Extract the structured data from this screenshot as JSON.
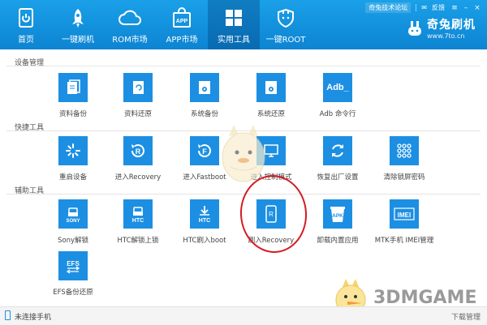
{
  "nav": {
    "items": [
      {
        "label": "首页",
        "icon": "phone-home-icon"
      },
      {
        "label": "一键刷机",
        "icon": "rocket-icon"
      },
      {
        "label": "ROM市场",
        "icon": "cloud-icon"
      },
      {
        "label": "APP市场",
        "icon": "shopping-bag-icon",
        "badge": "APP"
      },
      {
        "label": "实用工具",
        "icon": "grid-icon",
        "active": true
      },
      {
        "label": "一键ROOT",
        "icon": "rabbit-shield-icon"
      }
    ]
  },
  "topright": {
    "forum": "奇兔技术论坛",
    "feedback": "反馈"
  },
  "brand": {
    "name": "奇兔刷机",
    "url": "www.7to.cn"
  },
  "sections": {
    "device": "设备管理",
    "quick": "快捷工具",
    "aux": "辅助工具"
  },
  "tiles": {
    "device": [
      {
        "label": "资料备份",
        "icon": "document-backup-icon"
      },
      {
        "label": "资料还原",
        "icon": "document-restore-icon"
      },
      {
        "label": "系统备份",
        "icon": "system-backup-icon"
      },
      {
        "label": "系统还原",
        "icon": "system-restore-icon"
      },
      {
        "label": "Adb 命令行",
        "icon": "adb-terminal-icon",
        "text": "Adb_"
      }
    ],
    "quick": [
      {
        "label": "重启设备",
        "icon": "reboot-icon"
      },
      {
        "label": "进入Recovery",
        "icon": "recovery-icon",
        "text": "R"
      },
      {
        "label": "进入Fastboot",
        "icon": "fastboot-icon",
        "text": "F"
      },
      {
        "label": "进入控制模式",
        "icon": "control-mode-icon"
      },
      {
        "label": "恢复出厂设置",
        "icon": "factory-reset-icon"
      },
      {
        "label": "清除锁屏密码",
        "icon": "clear-lock-pattern-icon"
      }
    ],
    "aux": [
      {
        "label": "Sony解锁",
        "icon": "sony-unlock-icon",
        "text": "SONY"
      },
      {
        "label": "HTC解锁上锁",
        "icon": "htc-lock-icon",
        "text": "HTC"
      },
      {
        "label": "HTC刷入boot",
        "icon": "htc-boot-icon",
        "text": "HTC"
      },
      {
        "label": "刷入Recovery",
        "icon": "flash-recovery-icon",
        "text": "R"
      },
      {
        "label": "卸载内置应用",
        "icon": "uninstall-apk-icon",
        "text": "APK"
      },
      {
        "label": "MTK手机 IMEI管理",
        "icon": "imei-icon",
        "text": "IMEI"
      },
      {
        "label": "EFS备份还原",
        "icon": "efs-icon",
        "text": "EFS"
      }
    ]
  },
  "status": {
    "text": "未连接手机",
    "right": "下载管理"
  },
  "watermark": "3DMGAME",
  "colors": {
    "header": "#1396df",
    "tile": "#1c8fe3",
    "annotation": "#d51c24"
  }
}
